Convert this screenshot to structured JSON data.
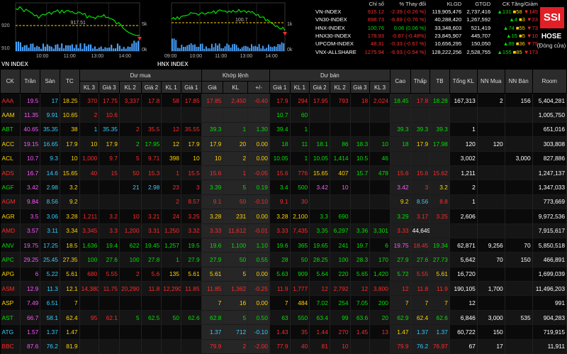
{
  "colors": {
    "up": "#00e000",
    "down": "#ff2a2a",
    "ref": "#ffd400",
    "ceiling": "#ff55ff",
    "floor": "#33ccff",
    "brand": "#e21f26"
  },
  "charts": [
    {
      "label": "VN INDEX",
      "yticks": [
        "920",
        "917.51",
        "910"
      ],
      "vticks": [
        "5k",
        "0k"
      ],
      "xticks": [
        "10:00",
        "11:00",
        "13:00",
        "14:00"
      ],
      "ref": "917.51"
    },
    {
      "label": "HNX INDEX",
      "yticks": [
        "100.7"
      ],
      "vticks": [
        "1k",
        "0k"
      ],
      "xticks": [
        "09:00",
        "10:00",
        "11:00",
        "13:00",
        "14:00"
      ],
      "ref": "100.7"
    }
  ],
  "index_table": {
    "headers": [
      "",
      "Chỉ số",
      "% Thay đổi",
      "KLGD",
      "GTGD",
      "CK Tăng/Giảm"
    ],
    "rows": [
      {
        "name": "VN-INDEX",
        "value": "915.12",
        "change": "-2.39 (-0.26 %)",
        "vol": "119,905,476",
        "val": "2,737,416",
        "up": "131",
        "ref": "58",
        "down": "145",
        "dir": "dn"
      },
      {
        "name": "VN30-INDEX",
        "value": "898.73",
        "change": "-6.89 (-0.76 %)",
        "vol": "40,288,420",
        "val": "1,267,592",
        "up": "4",
        "ref": "3",
        "down": "23",
        "dir": "dn"
      },
      {
        "name": "HNX-INDEX",
        "value": "100.76",
        "change": "0.06 (0.06 %)",
        "vol": "33,348,603",
        "val": "521,419",
        "up": "74",
        "ref": "55",
        "down": "73",
        "dir": "up"
      },
      {
        "name": "HNX30-INDEX",
        "value": "178.93",
        "change": "-0.87 (-0.48%)",
        "vol": "23,845,907",
        "val": "445,707",
        "up": "15",
        "ref": "5",
        "down": "10",
        "dir": "dn"
      },
      {
        "name": "UPCOM-INDEX",
        "value": "48.31",
        "change": "-0.33 (-0.67 %)",
        "vol": "10,656,295",
        "val": "150,050",
        "up": "89",
        "ref": "36",
        "down": "79",
        "dir": "dn"
      },
      {
        "name": "VNX-ALLSHARE",
        "value": "1275.94",
        "change": "-6.93 (-0.54 %)",
        "vol": "128,222,256",
        "val": "2,528,755",
        "up": "155",
        "ref": "85",
        "down": "173",
        "dir": "dn"
      }
    ]
  },
  "brand": {
    "logo": "SSI",
    "exchange": "HOSE",
    "status": "(Đóng cửa)"
  },
  "board": {
    "group_headers": {
      "buy": "Dư mua",
      "match": "Khớp lệnh",
      "sell": "Dư bán"
    },
    "headers": [
      "CK",
      "Trần",
      "Sàn",
      "TC",
      "KL 3",
      "Giá 3",
      "KL 2",
      "Giá 2",
      "KL 1",
      "Giá 1",
      "Giá",
      "KL",
      "+/-",
      "Giá 1",
      "KL 1",
      "Giá 2",
      "KL 2",
      "Giá 3",
      "KL 3",
      "Cao",
      "Thấp",
      "TB",
      "Tổng KL",
      "NN Mua",
      "NN Bán",
      "Room"
    ],
    "rows": [
      {
        "c": [
          "AAA",
          "19.5",
          "17",
          "18.25",
          "370",
          "17.75",
          "3,337",
          "17.8",
          "58",
          "17.85",
          "17.85",
          "2,450",
          "-0.40",
          "17.9",
          "294",
          "17.95",
          "793",
          "18",
          "2,024",
          "18.45",
          "17.8",
          "18.28",
          "167,313",
          "2",
          "156",
          "5,404,281"
        ],
        "k": [
          "dn",
          "ceil",
          "flr",
          "ref",
          "dn",
          "dn",
          "dn",
          "dn",
          "dn",
          "dn",
          "dn",
          "dn",
          "dn",
          "dn",
          "dn",
          "dn",
          "dn",
          "dn",
          "dn",
          "up",
          "dn",
          "up",
          "w",
          "w",
          "w",
          "w"
        ]
      },
      {
        "c": [
          "AAM",
          "11.35",
          "9.91",
          "10.65",
          "2",
          "10.6",
          "",
          "",
          "",
          "",
          "",
          "",
          "",
          "10.7",
          "60",
          "",
          "",
          "",
          "",
          "",
          "",
          "",
          "",
          "",
          "",
          "1,005,750"
        ],
        "k": [
          "sym",
          "ceil",
          "flr",
          "ref",
          "dn",
          "dn",
          "w",
          "w",
          "w",
          "w",
          "w",
          "w",
          "w",
          "up",
          "up",
          "w",
          "w",
          "w",
          "w",
          "w",
          "w",
          "w",
          "w",
          "w",
          "w",
          "w"
        ]
      },
      {
        "c": [
          "ABT",
          "40.65",
          "35.35",
          "38",
          "1",
          "35.35",
          "2",
          "35.5",
          "12",
          "35.55",
          "39.3",
          "1",
          "1.30",
          "39.4",
          "1",
          "",
          "",
          "",
          "",
          "39.3",
          "39.3",
          "39.3",
          "1",
          "",
          "",
          "651,016"
        ],
        "k": [
          "sym",
          "ceil",
          "flr",
          "ref",
          "flr",
          "flr",
          "dn",
          "dn",
          "dn",
          "dn",
          "up",
          "up",
          "up",
          "up",
          "up",
          "w",
          "w",
          "w",
          "w",
          "up",
          "up",
          "up",
          "w",
          "w",
          "w",
          "w"
        ]
      },
      {
        "c": [
          "ACC",
          "19.15",
          "16.65",
          "17.9",
          "10",
          "17.9",
          "2",
          "17.95",
          "12",
          "17.9",
          "17.9",
          "20",
          "0.00",
          "18",
          "11",
          "18.1",
          "86",
          "18.3",
          "10",
          "18",
          "17.9",
          "17.98",
          "120",
          "120",
          "",
          "303,808"
        ],
        "k": [
          "sym",
          "ceil",
          "flr",
          "ref",
          "ref",
          "ref",
          "up",
          "up",
          "ref",
          "ref",
          "ref",
          "ref",
          "ref",
          "up",
          "up",
          "up",
          "up",
          "up",
          "up",
          "up",
          "ref",
          "up",
          "w",
          "w",
          "w",
          "w"
        ]
      },
      {
        "c": [
          "ACL",
          "10.7",
          "9.3",
          "10",
          "1,000",
          "9.7",
          "5",
          "9.71",
          "398",
          "10",
          "10",
          "2",
          "0.00",
          "10.05",
          "1",
          "10.05",
          "1,414",
          "10.5",
          "46",
          "",
          "",
          "",
          "3,002",
          "",
          "3,000",
          "827,886"
        ],
        "k": [
          "sym",
          "ceil",
          "flr",
          "ref",
          "dn",
          "dn",
          "dn",
          "dn",
          "ref",
          "ref",
          "ref",
          "ref",
          "ref",
          "up",
          "up",
          "up",
          "up",
          "up",
          "up",
          "w",
          "w",
          "w",
          "w",
          "w",
          "w",
          "w"
        ]
      },
      {
        "c": [
          "ADS",
          "16.7",
          "14.6",
          "15.65",
          "40",
          "15",
          "50",
          "15.3",
          "1",
          "15.5",
          "15.6",
          "1",
          "-0.05",
          "15.6",
          "776",
          "15.65",
          "407",
          "15.7",
          "478",
          "15.6",
          "15.6",
          "15.62",
          "1,211",
          "",
          "",
          "1,247,137"
        ],
        "k": [
          "sym",
          "ceil",
          "flr",
          "ref",
          "dn",
          "dn",
          "dn",
          "dn",
          "dn",
          "dn",
          "dn",
          "dn",
          "dn",
          "dn",
          "dn",
          "ref",
          "ref",
          "up",
          "up",
          "dn",
          "dn",
          "dn",
          "w",
          "w",
          "w",
          "w"
        ]
      },
      {
        "c": [
          "AGF",
          "3.42",
          "2.98",
          "3.2",
          "",
          "",
          "21",
          "2.98",
          "23",
          "3",
          "3.39",
          "5",
          "0.19",
          "3.4",
          "500",
          "3.42",
          "10",
          "",
          "",
          "3.42",
          "3",
          "3.2",
          "2",
          "",
          "",
          "1,347,033"
        ],
        "k": [
          "sym",
          "ceil",
          "flr",
          "ref",
          "w",
          "w",
          "flr",
          "flr",
          "dn",
          "dn",
          "up",
          "up",
          "up",
          "up",
          "up",
          "ceil",
          "ceil",
          "w",
          "w",
          "ceil",
          "dn",
          "ref",
          "w",
          "w",
          "w",
          "w"
        ]
      },
      {
        "c": [
          "AGM",
          "9.84",
          "8.56",
          "9.2",
          "",
          "",
          "",
          "",
          "2",
          "8.57",
          "9.1",
          "50",
          "-0.10",
          "9.1",
          "30",
          "",
          "",
          "",
          "",
          "9.2",
          "8.56",
          "8.8",
          "1",
          "",
          "",
          "773,669"
        ],
        "k": [
          "sym",
          "ceil",
          "flr",
          "ref",
          "w",
          "w",
          "w",
          "w",
          "dn",
          "dn",
          "dn",
          "dn",
          "dn",
          "dn",
          "dn",
          "w",
          "w",
          "w",
          "w",
          "ref",
          "flr",
          "dn",
          "w",
          "w",
          "w",
          "w"
        ]
      },
      {
        "c": [
          "AGR",
          "3.5",
          "3.06",
          "3.28",
          "1,211",
          "3.2",
          "10",
          "3.21",
          "24",
          "3.25",
          "3.28",
          "231",
          "0.00",
          "3.28",
          "2,100",
          "3.3",
          "690",
          "",
          "",
          "3.29",
          "3.17",
          "3.25",
          "2,606",
          "",
          "",
          "9,972,536"
        ],
        "k": [
          "sym",
          "ceil",
          "flr",
          "ref",
          "dn",
          "dn",
          "dn",
          "dn",
          "dn",
          "dn",
          "ref",
          "ref",
          "ref",
          "ref",
          "ref",
          "up",
          "up",
          "w",
          "w",
          "up",
          "dn",
          "dn",
          "w",
          "w",
          "w",
          "w"
        ]
      },
      {
        "c": [
          "AMD",
          "3.57",
          "3.11",
          "3.34",
          "3,345",
          "3.3",
          "1,200",
          "3.31",
          "1,250",
          "3.32",
          "3.33",
          "11,612",
          "-0.01",
          "3.33",
          "7,435",
          "3.35",
          "6,297",
          "3.36",
          "3,301",
          "3.33",
          "44,649",
          "",
          "",
          "",
          "",
          "7,915,617"
        ],
        "k": [
          "sym",
          "ceil",
          "flr",
          "ref",
          "dn",
          "dn",
          "dn",
          "dn",
          "dn",
          "dn",
          "dn",
          "dn",
          "dn",
          "dn",
          "dn",
          "up",
          "up",
          "up",
          "up",
          "dn",
          "w",
          "w",
          "w",
          "w",
          "w",
          "w"
        ]
      },
      {
        "c": [
          "ANV",
          "19.75",
          "17.25",
          "18.5",
          "1,636",
          "19.4",
          "622",
          "19.45",
          "1,257",
          "19.5",
          "19.6",
          "1,100",
          "1.10",
          "19.6",
          "365",
          "19.65",
          "241",
          "19.7",
          "6",
          "19.75",
          "18.45",
          "19.34",
          "62,871",
          "9,256",
          "70",
          "5,850,518"
        ],
        "k": [
          "sym",
          "ceil",
          "flr",
          "ref",
          "up",
          "up",
          "up",
          "up",
          "up",
          "up",
          "up",
          "up",
          "up",
          "up",
          "up",
          "up",
          "up",
          "up",
          "up",
          "ceil",
          "dn",
          "up",
          "w",
          "w",
          "w",
          "w"
        ]
      },
      {
        "c": [
          "APC",
          "29.25",
          "25.45",
          "27.35",
          "100",
          "27.6",
          "100",
          "27.8",
          "1",
          "27.9",
          "27.9",
          "50",
          "0.55",
          "28",
          "50",
          "28.25",
          "100",
          "28.3",
          "170",
          "27.9",
          "27.6",
          "27.73",
          "5,642",
          "70",
          "150",
          "466,891"
        ],
        "k": [
          "sym",
          "ceil",
          "flr",
          "ref",
          "up",
          "up",
          "up",
          "up",
          "up",
          "up",
          "up",
          "up",
          "up",
          "up",
          "up",
          "up",
          "up",
          "up",
          "up",
          "up",
          "up",
          "up",
          "w",
          "w",
          "w",
          "w"
        ]
      },
      {
        "c": [
          "APG",
          "6",
          "5.22",
          "5.61",
          "680",
          "5.55",
          "2",
          "5.6",
          "135",
          "5.61",
          "5.61",
          "5",
          "0.00",
          "5.63",
          "909",
          "5.64",
          "220",
          "5.65",
          "1,420",
          "5.72",
          "5.55",
          "5.61",
          "16,720",
          "",
          "",
          "1,699,039"
        ],
        "k": [
          "sym",
          "ceil",
          "flr",
          "ref",
          "dn",
          "dn",
          "dn",
          "dn",
          "ref",
          "ref",
          "ref",
          "ref",
          "ref",
          "up",
          "up",
          "up",
          "up",
          "up",
          "up",
          "up",
          "dn",
          "ref",
          "w",
          "w",
          "w",
          "w"
        ]
      },
      {
        "c": [
          "ASM",
          "12.9",
          "11.3",
          "12.1",
          "14,380",
          "11.75",
          "20,290",
          "11.8",
          "12,290",
          "11.85",
          "11.85",
          "1,362",
          "-0.25",
          "11.9",
          "1,777",
          "12",
          "2,792",
          "12",
          "3,800",
          "12",
          "11.8",
          "11.9",
          "190,105",
          "1,700",
          "",
          "11,496,203"
        ],
        "k": [
          "sym",
          "ceil",
          "flr",
          "ref",
          "dn",
          "dn",
          "dn",
          "dn",
          "dn",
          "dn",
          "dn",
          "dn",
          "dn",
          "dn",
          "dn",
          "dn",
          "dn",
          "dn",
          "dn",
          "dn",
          "dn",
          "dn",
          "w",
          "w",
          "w",
          "w"
        ]
      },
      {
        "c": [
          "ASP",
          "7.49",
          "6.51",
          "7",
          "",
          "",
          "",
          "",
          "",
          "",
          "7",
          "16",
          "0.00",
          "7",
          "484",
          "7.02",
          "254",
          "7.05",
          "200",
          "7",
          "7",
          "7",
          "12",
          "",
          "",
          "991"
        ],
        "k": [
          "sym",
          "ceil",
          "flr",
          "ref",
          "w",
          "w",
          "w",
          "w",
          "w",
          "w",
          "ref",
          "ref",
          "ref",
          "ref",
          "ref",
          "up",
          "up",
          "up",
          "up",
          "ref",
          "ref",
          "ref",
          "w",
          "w",
          "w",
          "w"
        ]
      },
      {
        "c": [
          "AST",
          "66.7",
          "58.1",
          "62.4",
          "95",
          "62.1",
          "5",
          "62.5",
          "50",
          "62.6",
          "62.8",
          "5",
          "0.50",
          "63",
          "550",
          "63.4",
          "99",
          "63.6",
          "20",
          "62.9",
          "62.4",
          "62.6",
          "6,846",
          "3,000",
          "535",
          "904,283"
        ],
        "k": [
          "sym",
          "ceil",
          "flr",
          "ref",
          "dn",
          "dn",
          "up",
          "up",
          "up",
          "up",
          "up",
          "up",
          "up",
          "up",
          "up",
          "up",
          "up",
          "up",
          "up",
          "up",
          "ref",
          "up",
          "w",
          "w",
          "w",
          "w"
        ]
      },
      {
        "c": [
          "ATG",
          "1.57",
          "1.37",
          "1.47",
          "",
          "",
          "",
          "",
          "",
          "",
          "1.37",
          "712",
          "-0.10",
          "1.43",
          "35",
          "1.44",
          "270",
          "1.45",
          "13",
          "1.47",
          "1.37",
          "1.37",
          "60,722",
          "150",
          "",
          "719,915"
        ],
        "k": [
          "sym",
          "ceil",
          "flr",
          "ref",
          "w",
          "w",
          "w",
          "w",
          "w",
          "w",
          "flr",
          "flr",
          "flr",
          "dn",
          "dn",
          "dn",
          "dn",
          "dn",
          "dn",
          "ref",
          "flr",
          "flr",
          "w",
          "w",
          "w",
          "w"
        ]
      },
      {
        "c": [
          "BBC",
          "87.6",
          "76.2",
          "81.9",
          "",
          "",
          "",
          "",
          "",
          "",
          "79.9",
          "2",
          "-2.00",
          "77.9",
          "40",
          "81",
          "10",
          "",
          "",
          "79.9",
          "76.2",
          "76.97",
          "67",
          "17",
          "",
          "11,911"
        ],
        "k": [
          "sym",
          "ceil",
          "flr",
          "ref",
          "w",
          "w",
          "w",
          "w",
          "w",
          "w",
          "dn",
          "dn",
          "dn",
          "dn",
          "dn",
          "dn",
          "dn",
          "w",
          "w",
          "dn",
          "flr",
          "dn",
          "w",
          "w",
          "w",
          "w"
        ]
      }
    ],
    "sym_dir": [
      "dn",
      "ref",
      "up",
      "ref",
      "ref",
      "dn",
      "up",
      "dn",
      "ref",
      "dn",
      "up",
      "up",
      "ref",
      "dn",
      "ref",
      "up",
      "flr",
      "dn"
    ]
  }
}
